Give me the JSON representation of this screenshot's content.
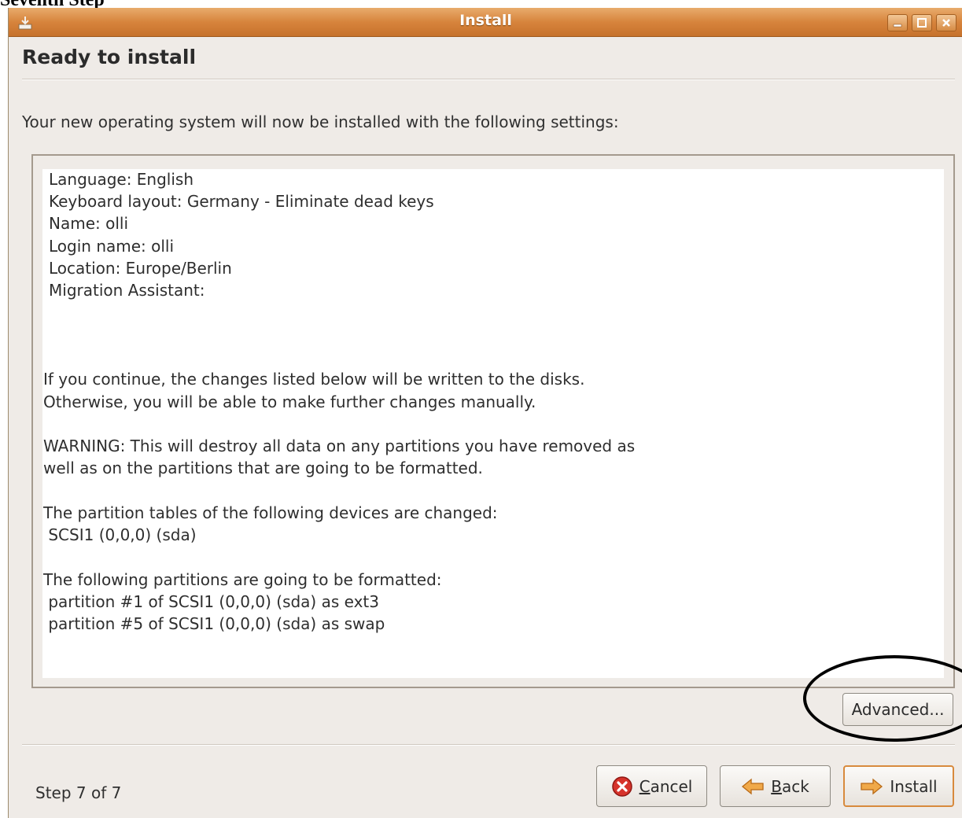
{
  "caption": "Seventh Step",
  "window": {
    "title": "Install",
    "controls": [
      "minimize-icon",
      "maximize-icon",
      "close-icon"
    ]
  },
  "page": {
    "heading": "Ready to install",
    "intro": "Your new operating system will now be installed with the following settings:"
  },
  "summary": {
    "settings": [
      "Language: English",
      "Keyboard layout: Germany - Eliminate dead keys",
      "Name: olli",
      "Login name: olli",
      "Location: Europe/Berlin",
      "Migration Assistant:"
    ],
    "notice": [
      "If you continue, the changes listed below will be written to the disks.",
      "Otherwise, you will be able to make further changes manually."
    ],
    "warning": [
      "WARNING: This will destroy all data on any partitions you have removed as",
      "well as on the partitions that are going to be formatted."
    ],
    "partition_tables": [
      "The partition tables of the following devices are changed:",
      " SCSI1 (0,0,0) (sda)"
    ],
    "formatted": [
      "The following partitions are going to be formatted:",
      " partition #1 of SCSI1 (0,0,0) (sda) as ext3",
      " partition #5 of SCSI1 (0,0,0) (sda) as swap"
    ]
  },
  "buttons": {
    "advanced": "Advanced...",
    "cancel_mnemonic": "C",
    "cancel_rest": "ancel",
    "back_mnemonic": "B",
    "back_rest": "ack",
    "install": "Install"
  },
  "footer": {
    "step": "Step 7 of 7"
  },
  "colors": {
    "titlebar": "#d7843c",
    "dialog_bg": "#efebe7",
    "install_border": "#d88a3d",
    "annotation": "#000000"
  }
}
